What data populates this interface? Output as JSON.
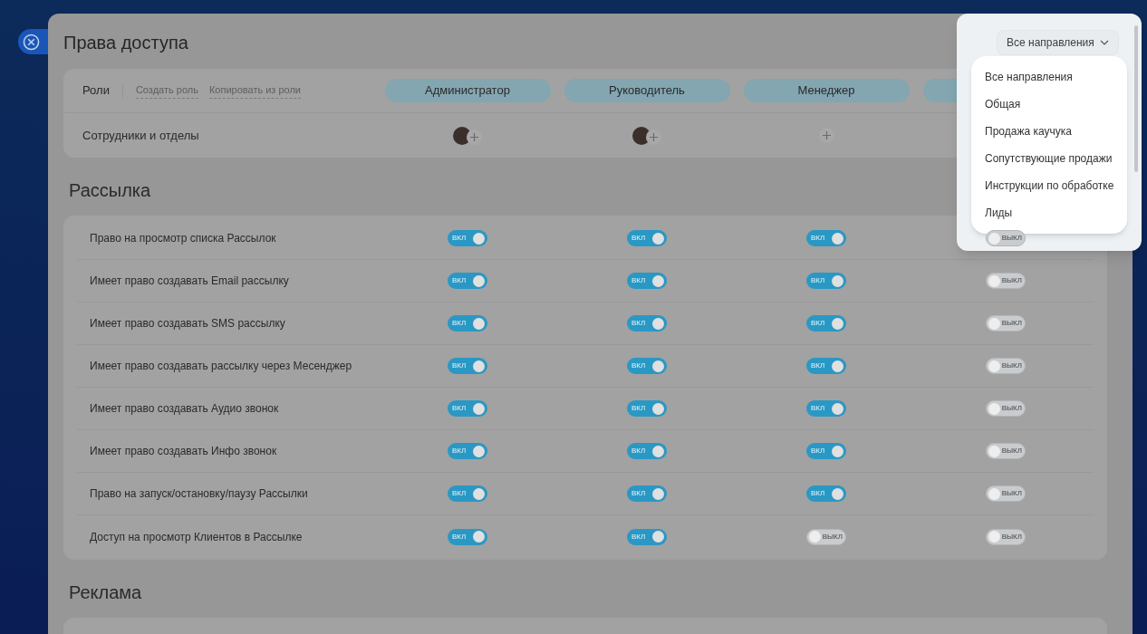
{
  "title": "Права доступа",
  "roles_header": {
    "label": "Роли",
    "links": [
      "Создать роль",
      "Копировать из роли"
    ]
  },
  "roles": [
    {
      "name": "Администратор"
    },
    {
      "name": "Руководитель"
    },
    {
      "name": "Менеджер"
    }
  ],
  "members": {
    "label": "Сотрудники и отделы",
    "cells": [
      {
        "has_avatar": true
      },
      {
        "has_avatar": true
      },
      {
        "has_avatar": false
      }
    ]
  },
  "sections": [
    {
      "title": "Рассылка",
      "rows": [
        {
          "label": "Право на просмотр списка Рассылок",
          "toggles": [
            {
              "on": true,
              "label": "ВКЛ"
            },
            {
              "on": true,
              "label": "ВКЛ"
            },
            {
              "on": true,
              "label": "ВКЛ"
            },
            {
              "on": false,
              "label": "ВЫКЛ"
            }
          ]
        },
        {
          "label": "Имеет право создавать Email рассылку",
          "toggles": [
            {
              "on": true,
              "label": "ВКЛ"
            },
            {
              "on": true,
              "label": "ВКЛ"
            },
            {
              "on": true,
              "label": "ВКЛ"
            },
            {
              "on": false,
              "label": "ВЫКЛ"
            }
          ]
        },
        {
          "label": "Имеет право создавать SMS рассылку",
          "toggles": [
            {
              "on": true,
              "label": "ВКЛ"
            },
            {
              "on": true,
              "label": "ВКЛ"
            },
            {
              "on": true,
              "label": "ВКЛ"
            },
            {
              "on": false,
              "label": "ВЫКЛ"
            }
          ]
        },
        {
          "label": "Имеет право создавать рассылку через Месенджер",
          "toggles": [
            {
              "on": true,
              "label": "ВКЛ"
            },
            {
              "on": true,
              "label": "ВКЛ"
            },
            {
              "on": true,
              "label": "ВКЛ"
            },
            {
              "on": false,
              "label": "ВЫКЛ"
            }
          ]
        },
        {
          "label": "Имеет право создавать Аудио звонок",
          "toggles": [
            {
              "on": true,
              "label": "ВКЛ"
            },
            {
              "on": true,
              "label": "ВКЛ"
            },
            {
              "on": true,
              "label": "ВКЛ"
            },
            {
              "on": false,
              "label": "ВЫКЛ"
            }
          ]
        },
        {
          "label": "Имеет право создавать Инфо звонок",
          "toggles": [
            {
              "on": true,
              "label": "ВКЛ"
            },
            {
              "on": true,
              "label": "ВКЛ"
            },
            {
              "on": true,
              "label": "ВКЛ"
            },
            {
              "on": false,
              "label": "ВЫКЛ"
            }
          ]
        },
        {
          "label": "Право на запуск/остановку/паузу Рассылки",
          "toggles": [
            {
              "on": true,
              "label": "ВКЛ"
            },
            {
              "on": true,
              "label": "ВКЛ"
            },
            {
              "on": true,
              "label": "ВКЛ"
            },
            {
              "on": false,
              "label": "ВЫКЛ"
            }
          ]
        },
        {
          "label": "Доступ на просмотр Клиентов в Рассылке",
          "toggles": [
            {
              "on": true,
              "label": "ВКЛ"
            },
            {
              "on": true,
              "label": "ВКЛ"
            },
            {
              "on": false,
              "label": "ВЫКЛ"
            },
            {
              "on": false,
              "label": "ВЫКЛ"
            }
          ]
        }
      ]
    },
    {
      "title": "Реклама"
    }
  ],
  "direction_filter": {
    "label": "Все направления",
    "options": [
      "Все направления",
      "Общая",
      "Продажа каучука",
      "Сопутствующие продажи",
      "Инструкции по обработке",
      "Лиды"
    ]
  }
}
